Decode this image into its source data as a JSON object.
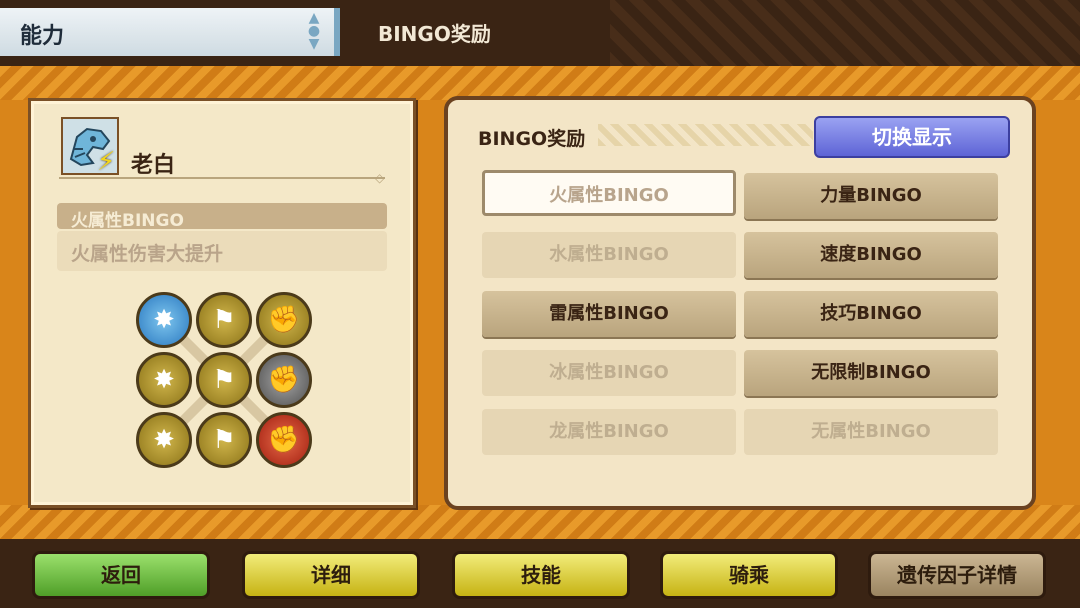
{
  "header": {
    "title": "能力",
    "subtitle": "BINGO奖励"
  },
  "monster": {
    "name": "老白",
    "icon": "zinogre-icon",
    "element_icon": "lightning-icon"
  },
  "selected_skill": {
    "name": "火属性BINGO",
    "description": "火属性伤害大提升"
  },
  "genes": [
    {
      "color": "blue",
      "icon": "burst-icon"
    },
    {
      "color": "gold",
      "icon": "runner-icon"
    },
    {
      "color": "gold",
      "icon": "flex-icon"
    },
    {
      "color": "gold",
      "icon": "burst-icon"
    },
    {
      "color": "gold",
      "icon": "runner-icon"
    },
    {
      "color": "gray",
      "icon": "flex-icon"
    },
    {
      "color": "gold",
      "icon": "burst-icon"
    },
    {
      "color": "gold",
      "icon": "runner-icon"
    },
    {
      "color": "red",
      "icon": "flex-icon"
    }
  ],
  "bingo_panel": {
    "header": "BINGO奖励",
    "switch_label": "切换显示",
    "left_column": [
      {
        "label": "火属性BINGO",
        "state": "selected"
      },
      {
        "label": "水属性BINGO",
        "state": "dim"
      },
      {
        "label": "雷属性BINGO",
        "state": "active"
      },
      {
        "label": "冰属性BINGO",
        "state": "dim"
      },
      {
        "label": "龙属性BINGO",
        "state": "dim"
      }
    ],
    "right_column": [
      {
        "label": "力量BINGO",
        "state": "active"
      },
      {
        "label": "速度BINGO",
        "state": "active"
      },
      {
        "label": "技巧BINGO",
        "state": "active"
      },
      {
        "label": "无限制BINGO",
        "state": "active"
      },
      {
        "label": "无属性BINGO",
        "state": "dim"
      }
    ]
  },
  "bottom_buttons": {
    "back": "返回",
    "details": "详细",
    "skills": "技能",
    "ride": "骑乘",
    "gene_details": "遗传因子详情"
  }
}
